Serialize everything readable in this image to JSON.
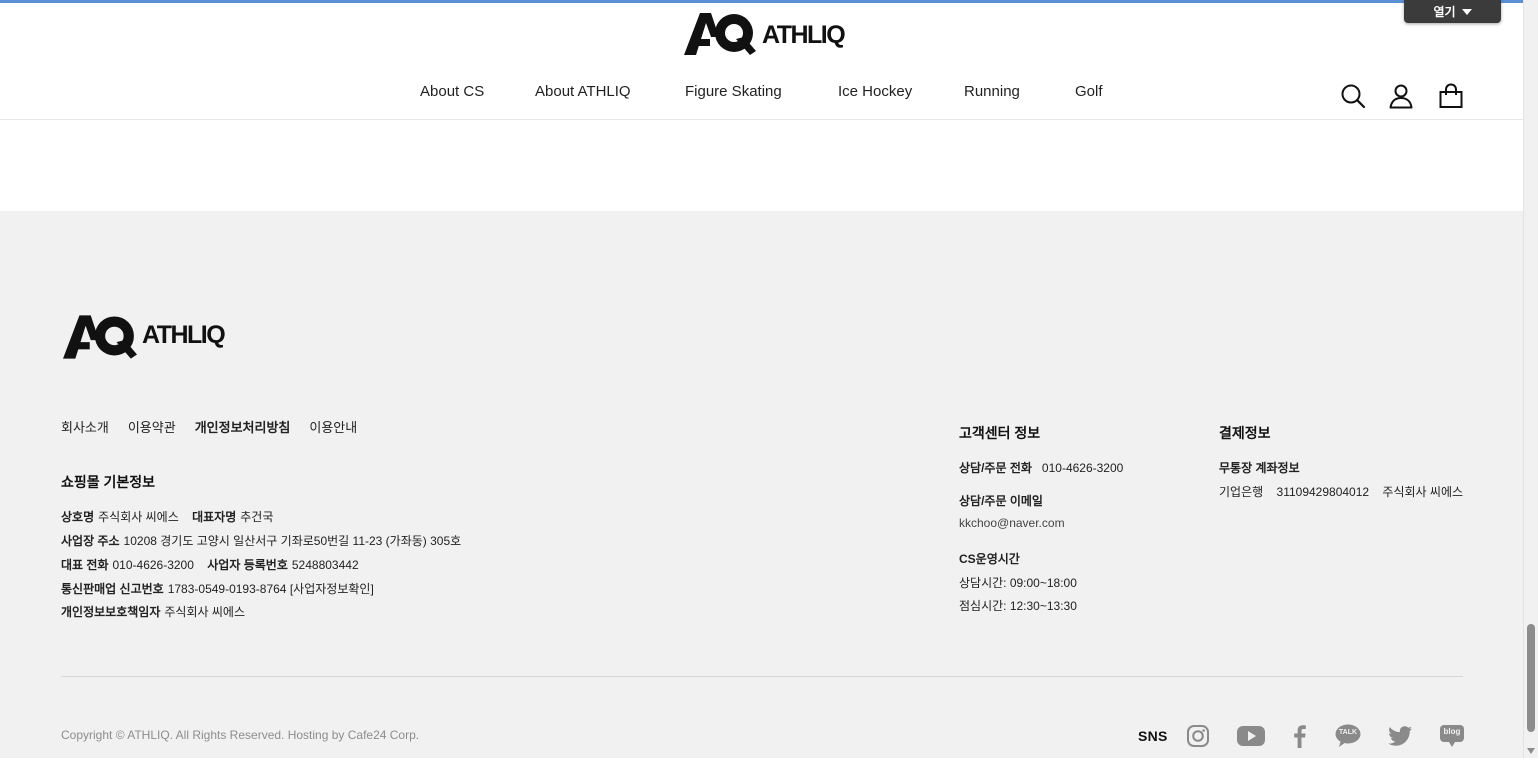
{
  "brand": {
    "name": "ATHLIQ"
  },
  "toolbar": {
    "open_label": "열기"
  },
  "nav": {
    "items": [
      {
        "label": "About CS"
      },
      {
        "label": "About ATHLIQ"
      },
      {
        "label": "Figure Skating"
      },
      {
        "label": "Ice Hockey"
      },
      {
        "label": "Running"
      },
      {
        "label": "Golf"
      }
    ]
  },
  "icons": {
    "search": "search-icon",
    "account": "user-icon",
    "cart": "shopping-bag-icon"
  },
  "footer": {
    "links": [
      {
        "label": "회사소개"
      },
      {
        "label": "이용약관"
      },
      {
        "label": "개인정보처리방침"
      },
      {
        "label": "이용안내"
      }
    ],
    "shop_info": {
      "title": "쇼핑몰 기본정보",
      "company_label": "상호명",
      "company_value": "주식회사 씨에스",
      "ceo_label": "대표자명",
      "ceo_value": "추건국",
      "address_label": "사업장 주소",
      "address_value": "10208 경기도 고양시 일산서구 기좌로50번길 11-23 (가좌동) 305호",
      "phone_label": "대표 전화",
      "phone_value": "010-4626-3200",
      "bizno_label": "사업자 등록번호",
      "bizno_value": "5248803442",
      "ecommerce_label": "통신판매업 신고번호",
      "ecommerce_value": "1783-0549-0193-8764",
      "bizinfo_link": "[사업자정보확인]",
      "privacy_label": "개인정보보호책임자",
      "privacy_value": "주식회사 씨에스"
    },
    "cs": {
      "title": "고객센터 정보",
      "phone_label": "상담/주문 전화",
      "phone_value": "010-4626-3200",
      "email_label": "상담/주문 이메일",
      "email_value": "kkchoo@naver.com",
      "hours_title": "CS운영시간",
      "hours_consult": "상담시간: 09:00~18:00",
      "hours_lunch": "점심시간: 12:30~13:30"
    },
    "payment": {
      "title": "결제정보",
      "account_title": "무통장 계좌정보",
      "bank": "기업은행",
      "account_no": "31109429804012",
      "holder": "주식회사 씨에스"
    },
    "copyright": "Copyright © ATHLIQ. All Rights Reserved. Hosting by Cafe24 Corp.",
    "sns_label": "SNS",
    "sns_icons": [
      "instagram-icon",
      "youtube-icon",
      "facebook-icon",
      "kakaotalk-icon",
      "twitter-icon",
      "blog-icon"
    ],
    "kakao_text": "TALK",
    "blog_text": "blog"
  },
  "colors": {
    "accent_topline": "#5b8fd6",
    "footer_bg": "#f1f1f2",
    "sns_gray": "#8a8a8a"
  }
}
